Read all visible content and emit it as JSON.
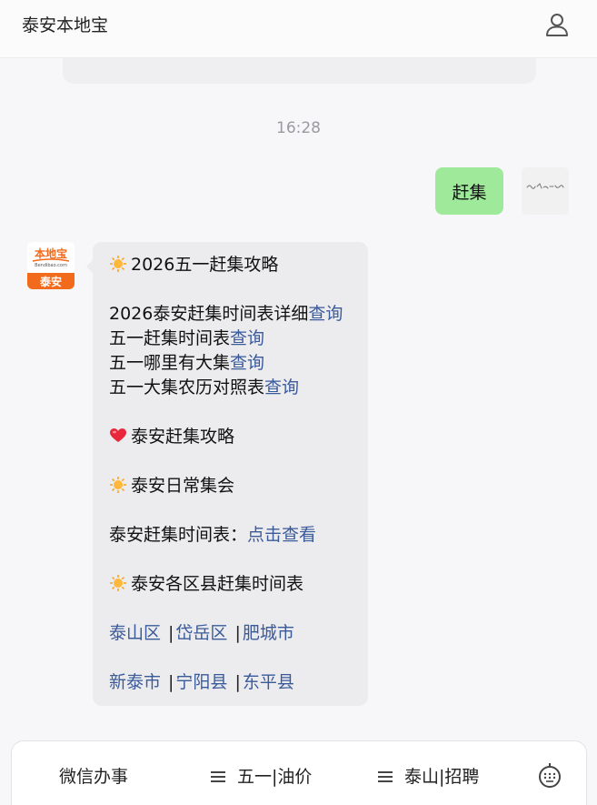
{
  "header": {
    "title": "泰安本地宝",
    "user_icon": "user-icon"
  },
  "chat": {
    "timestamp": "16:28",
    "user_message": "赶集",
    "bot": {
      "avatar_text_top": "本地宝",
      "avatar_text_sub": "Bendibao.com",
      "avatar_text_bottom": "泰安",
      "title": "2026五一赶集攻略",
      "lines": [
        {
          "text": "2026泰安赶集时间表详细",
          "link": "查询"
        },
        {
          "text": "五一赶集时间表",
          "link": "查询"
        },
        {
          "text": "五一哪里有大集",
          "link": "查询"
        },
        {
          "text": "五一大集农历对照表",
          "link": "查询"
        }
      ],
      "heart_heading": "泰安赶集攻略",
      "daily_heading": "泰安日常集会",
      "schedule_label": "泰安赶集时间表：",
      "schedule_link": "点击查看",
      "counties_heading": "泰安各区县赶集时间表",
      "counties_row1": [
        "泰山区",
        "岱岳区",
        "肥城市"
      ],
      "counties_row2": [
        "新泰市",
        "宁阳县",
        "东平县"
      ],
      "separator": "|"
    }
  },
  "bottom_menu": {
    "items": [
      "微信办事",
      "五一|油价",
      "泰山|招聘"
    ],
    "keyboard_icon": "keyboard-icon"
  },
  "colors": {
    "link": "#3a5a9a",
    "user_bubble": "#9ee99a",
    "bot_bubble": "#ececef",
    "brand_orange": "#f26a1b"
  }
}
